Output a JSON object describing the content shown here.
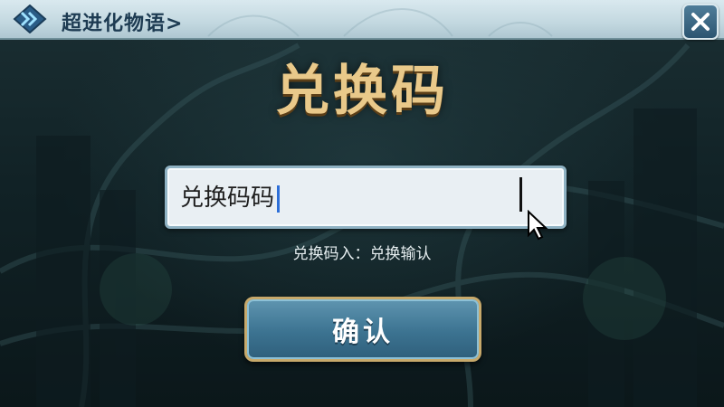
{
  "header": {
    "breadcrumb": "超进化物语>",
    "app_badge_icon": "double-chevron-badge-icon",
    "close_icon": "close-x-icon"
  },
  "redeem": {
    "title": "兑换码",
    "input_value": "兑换码码",
    "hint": "兑换码入：兑换输认",
    "confirm_label": "确认"
  },
  "colors": {
    "title_gold": "#e9c98a",
    "topbar": "#c3d8e0",
    "button_blue": "#3c7391",
    "button_border_gold": "#c7a96b",
    "caret_blue": "#2d6fd8"
  }
}
